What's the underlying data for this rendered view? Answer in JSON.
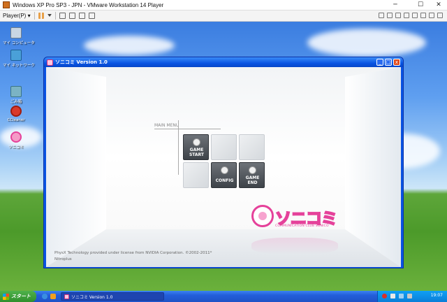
{
  "vmware": {
    "title": "Windows XP Pro SP3 - JPN - VMware Workstation 14 Player",
    "player_menu": "Player(P) ▾",
    "controls": {
      "minimize": "─",
      "maximize": "☐",
      "close": "✕"
    }
  },
  "desktop_icons": [
    {
      "label": "マイ コンピュータ",
      "icon": "my-computer-icon",
      "color": "#c9d6e3"
    },
    {
      "label": "マイ ネットワーク",
      "icon": "network-icon",
      "color": "#4aa0d8"
    },
    {
      "label": "ごみ箱",
      "icon": "recycle-bin-icon",
      "color": "#7bb3c4"
    },
    {
      "label": "CCleaner",
      "icon": "ccleaner-icon",
      "color": "#d93a2a"
    },
    {
      "label": "ソニコミ",
      "icon": "sonicomi-icon",
      "color": "#f59ac7"
    }
  ],
  "app": {
    "title": "ソニコミ Version 1.0",
    "controls": {
      "minimize": "_",
      "maximize": "□",
      "close": "x"
    },
    "menu_label": "MAIN MENU",
    "tiles": [
      {
        "name": "game-start-tile",
        "icon": "controller-icon",
        "line1": "GAME",
        "line2": "START",
        "active": true
      },
      {
        "name": "empty-tile-1",
        "line1": "",
        "line2": "",
        "active": false
      },
      {
        "name": "empty-tile-2",
        "line1": "",
        "line2": "",
        "active": false
      },
      {
        "name": "empty-tile-3",
        "line1": "",
        "line2": "",
        "active": false
      },
      {
        "name": "config-tile",
        "icon": "wrench-icon",
        "line1": "CONFIG",
        "line2": "",
        "active": true
      },
      {
        "name": "game-end-tile",
        "icon": "play-icon",
        "line1": "GAME",
        "line2": "END",
        "active": true
      }
    ],
    "logo": {
      "name": "ソニコミ",
      "subtitle": "COMMUNICATION CLUB SONICO"
    },
    "footer": {
      "line1": "PhysX Technology provided under license from NVIDIA Corporation. ©2002-2011*",
      "line2": "Nitroplus"
    }
  },
  "taskbar": {
    "start_label": "スタート",
    "task_item": "ソニコミ Version 1.0",
    "clock": "19:07"
  },
  "colors": {
    "xp_blue": "#0a54e3",
    "xp_green": "#2f8f2c",
    "sonico_pink": "#e5419a"
  }
}
